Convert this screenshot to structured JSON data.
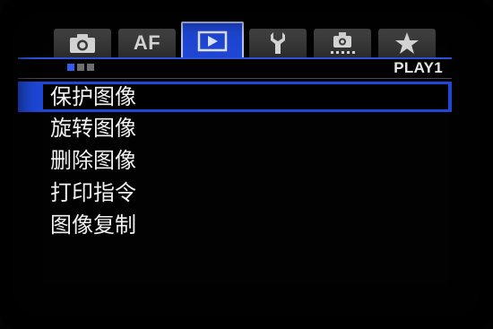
{
  "tabs": [
    {
      "name": "shooting",
      "icon": "camera-icon",
      "label": ""
    },
    {
      "name": "af",
      "icon": "",
      "label": "AF"
    },
    {
      "name": "playback",
      "icon": "play-icon",
      "label": "",
      "active": true
    },
    {
      "name": "setup",
      "icon": "wrench-icon",
      "label": ""
    },
    {
      "name": "custom-functions",
      "icon": "camera-dial-icon",
      "label": ""
    },
    {
      "name": "my-menu",
      "icon": "star-icon",
      "label": ""
    }
  ],
  "page": {
    "name": "PLAY1",
    "indicator_total": 3,
    "indicator_current": 1
  },
  "menu": {
    "items": [
      {
        "label": "保护图像",
        "selected": true
      },
      {
        "label": "旋转图像"
      },
      {
        "label": "删除图像"
      },
      {
        "label": "打印指令"
      },
      {
        "label": "图像复制"
      }
    ]
  },
  "colors": {
    "accent": "#1e46d2",
    "page_dot_active": "#2f5ef0",
    "page_dot_inactive": "#6e6e6e",
    "text": "#f2f2f2"
  }
}
